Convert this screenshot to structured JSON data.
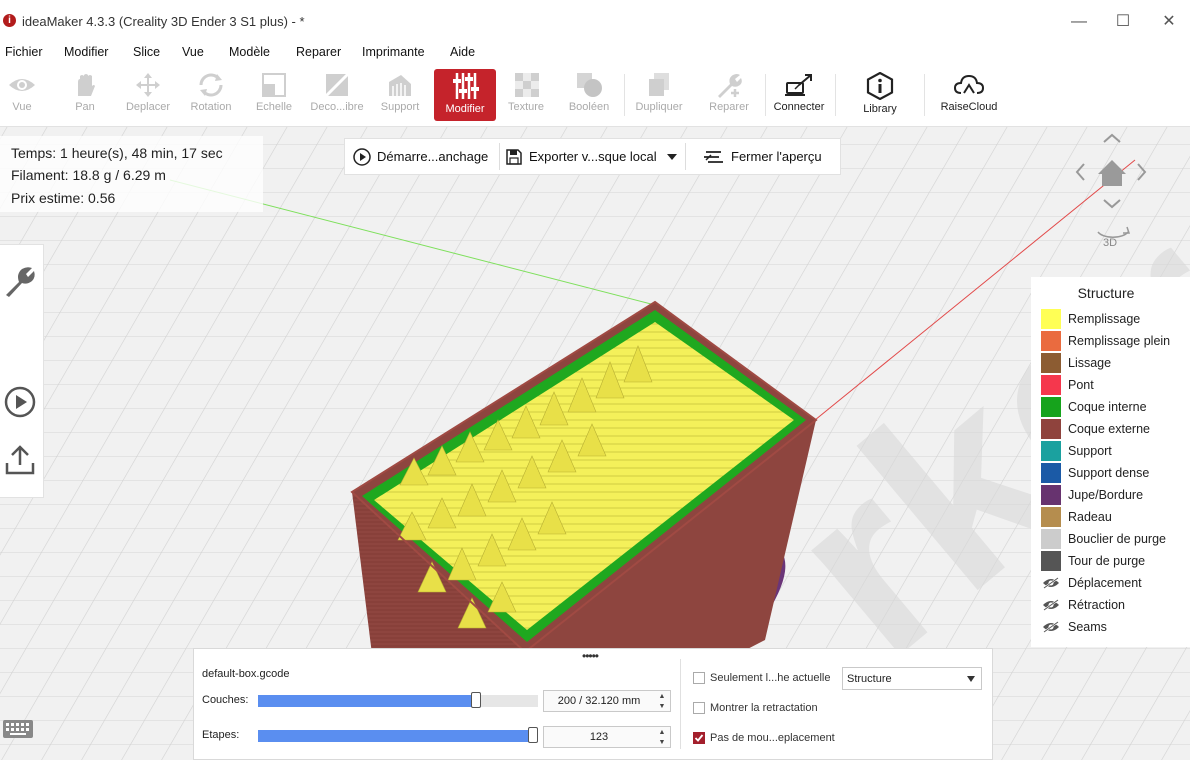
{
  "window": {
    "title": "ideaMaker 4.3.3 (Creality 3D Ender 3 S1 plus) - *",
    "logo_text": "i",
    "controls": {
      "minimize": "—",
      "maximize": "☐",
      "close": "✕"
    }
  },
  "menu": [
    "Fichier",
    "Modifier",
    "Slice",
    "Vue",
    "Modèle",
    "Reparer",
    "Imprimante",
    "Aide"
  ],
  "toolbar": [
    {
      "label": "Vue",
      "icon": "eye-icon",
      "state": "disabled"
    },
    {
      "label": "Pan",
      "icon": "hand-icon",
      "state": "disabled"
    },
    {
      "label": "Deplacer",
      "icon": "move-icon",
      "state": "disabled"
    },
    {
      "label": "Rotation",
      "icon": "rotate-icon",
      "state": "disabled"
    },
    {
      "label": "Echelle",
      "icon": "scale-icon",
      "state": "disabled"
    },
    {
      "label": "Deco...ibre",
      "icon": "cut-icon",
      "state": "disabled"
    },
    {
      "label": "Support",
      "icon": "support-icon",
      "state": "disabled"
    },
    {
      "label": "Modifier",
      "icon": "sliders-icon",
      "state": "active"
    },
    {
      "label": "Texture",
      "icon": "texture-icon",
      "state": "disabled"
    },
    {
      "label": "Booléen",
      "icon": "boolean-icon",
      "state": "disabled"
    },
    {
      "label": "Dupliquer",
      "icon": "duplicate-icon",
      "state": "disabled"
    },
    {
      "label": "Reparer",
      "icon": "wrench-plus-icon",
      "state": "disabled"
    },
    {
      "label": "Connecter",
      "icon": "connect-icon",
      "state": "enabled"
    },
    {
      "label": "Library",
      "icon": "info-hexagon-icon",
      "state": "enabled"
    },
    {
      "label": "RaiseCloud",
      "icon": "cloud-icon",
      "state": "enabled"
    }
  ],
  "slice_info": {
    "time": "Temps: 1 heure(s), 48 min, 17 sec",
    "filament": "Filament: 18.8 g / 6.29 m",
    "price": "Prix estime: 0.56"
  },
  "preview_bar": {
    "start": "Démarre...anchage",
    "export": "Exporter v...sque local",
    "close": "Fermer l'aperçu"
  },
  "nav": {
    "view_3d": "3D"
  },
  "legend": {
    "title": "Structure",
    "items": [
      {
        "label": "Remplissage",
        "color": "#ffff55"
      },
      {
        "label": "Remplissage plein",
        "color": "#ea6b3f"
      },
      {
        "label": "Lissage",
        "color": "#8c5c32"
      },
      {
        "label": "Pont",
        "color": "#f5374d"
      },
      {
        "label": "Coque interne",
        "color": "#16a31c"
      },
      {
        "label": "Coque externe",
        "color": "#8f433d"
      },
      {
        "label": "Support",
        "color": "#1ba19f"
      },
      {
        "label": "Support dense",
        "color": "#1b5aa6"
      },
      {
        "label": "Jupe/Bordure",
        "color": "#67336f"
      },
      {
        "label": "Radeau",
        "color": "#b58d4e"
      },
      {
        "label": "Bouclier de purge",
        "color": "#cccccc"
      },
      {
        "label": "Tour de purge",
        "color": "#555555"
      },
      {
        "label": "Déplacement",
        "hidden": true
      },
      {
        "label": "Rétraction",
        "hidden": true
      },
      {
        "label": "Seams",
        "hidden": true
      }
    ]
  },
  "bottom": {
    "filename": "default-box.gcode",
    "layers_label": "Couches:",
    "layers_value": "200 / 32.120 mm",
    "layers_progress": 0.79,
    "steps_label": "Etapes:",
    "steps_value": "123",
    "steps_progress": 1.0,
    "chk_current": "Seulement l...he actuelle",
    "chk_retract": "Montrer la retractation",
    "chk_travel": "Pas de mou...eplacement",
    "dropdown": "Structure",
    "drag_handle": "•••••"
  }
}
